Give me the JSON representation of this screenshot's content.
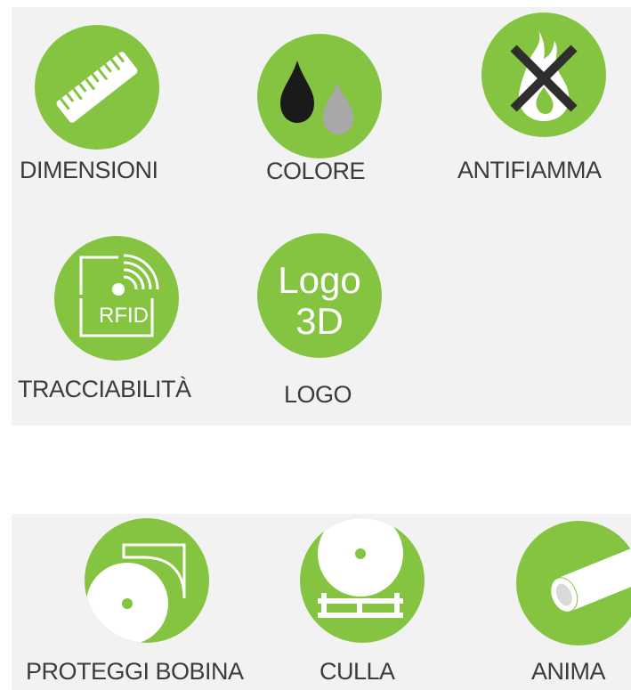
{
  "features_top": [
    {
      "id": "dimensioni",
      "label": "DIMENSIONI",
      "icon": "ruler-icon"
    },
    {
      "id": "colore",
      "label": "COLORE",
      "icon": "ink-drops-icon"
    },
    {
      "id": "antifiamma",
      "label": "ANTIFIAMMA",
      "icon": "no-flame-icon"
    },
    {
      "id": "tracciabilita",
      "label": "TRACCIABILITÀ",
      "icon": "rfid-icon",
      "icon_text": "RFID"
    },
    {
      "id": "logo",
      "label": "LOGO",
      "icon": "logo-3d-icon",
      "icon_text_line1": "Logo",
      "icon_text_line2": "3D"
    }
  ],
  "features_bottom": [
    {
      "id": "proteggi-bobina",
      "label": "PROTEGGI BOBINA",
      "icon": "reel-protector-icon"
    },
    {
      "id": "culla",
      "label": "CULLA",
      "icon": "reel-cradle-icon"
    },
    {
      "id": "anima",
      "label": "ANIMA",
      "icon": "core-tube-icon"
    }
  ],
  "colors": {
    "accent_green": "#84c441",
    "panel_bg": "#f2f2f2",
    "label_text": "#3c3c3c",
    "drop_black": "#1a1a1a",
    "drop_gray": "#a8a8a8"
  }
}
